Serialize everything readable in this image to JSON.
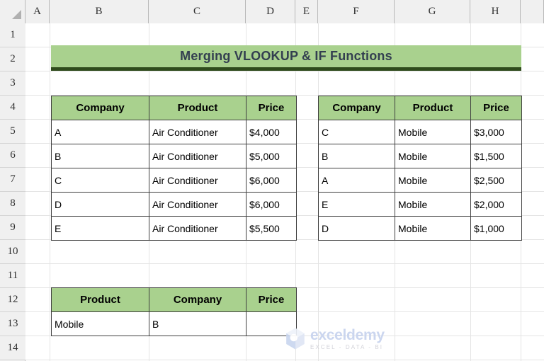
{
  "app": {
    "type": "spreadsheet",
    "column_headers": [
      "A",
      "B",
      "C",
      "D",
      "E",
      "F",
      "G",
      "H"
    ],
    "row_headers": [
      "1",
      "2",
      "3",
      "4",
      "5",
      "6",
      "7",
      "8",
      "9",
      "10",
      "11",
      "12",
      "13",
      "14"
    ],
    "select_all_icon": "select-all-triangle-icon"
  },
  "banner": {
    "title": "Merging VLOOKUP & IF Functions",
    "bg_color": "#a9d18e",
    "underline_color": "#2f4b1c",
    "text_color": "#333f50"
  },
  "tables": {
    "air_conditioner": {
      "headers": [
        "Company",
        "Product",
        "Price"
      ],
      "rows": [
        [
          "A",
          "Air Conditioner",
          "$4,000"
        ],
        [
          "B",
          "Air Conditioner",
          "$5,000"
        ],
        [
          "C",
          "Air Conditioner",
          "$6,000"
        ],
        [
          "D",
          "Air Conditioner",
          "$6,000"
        ],
        [
          "E",
          "Air Conditioner",
          "$5,500"
        ]
      ]
    },
    "mobile": {
      "headers": [
        "Company",
        "Product",
        "Price"
      ],
      "rows": [
        [
          "C",
          "Mobile",
          "$3,000"
        ],
        [
          "B",
          "Mobile",
          "$1,500"
        ],
        [
          "A",
          "Mobile",
          "$2,500"
        ],
        [
          "E",
          "Mobile",
          "$2,000"
        ],
        [
          "D",
          "Mobile",
          "$1,000"
        ]
      ]
    },
    "lookup_result": {
      "headers": [
        "Product",
        "Company",
        "Price"
      ],
      "rows": [
        [
          "Mobile",
          "B",
          ""
        ]
      ]
    }
  },
  "watermark": {
    "title": "exceldemy",
    "subtitle": "EXCEL - DATA - BI",
    "title_color": "#c7d3ee",
    "subtitle_color": "#cfcfd6"
  }
}
